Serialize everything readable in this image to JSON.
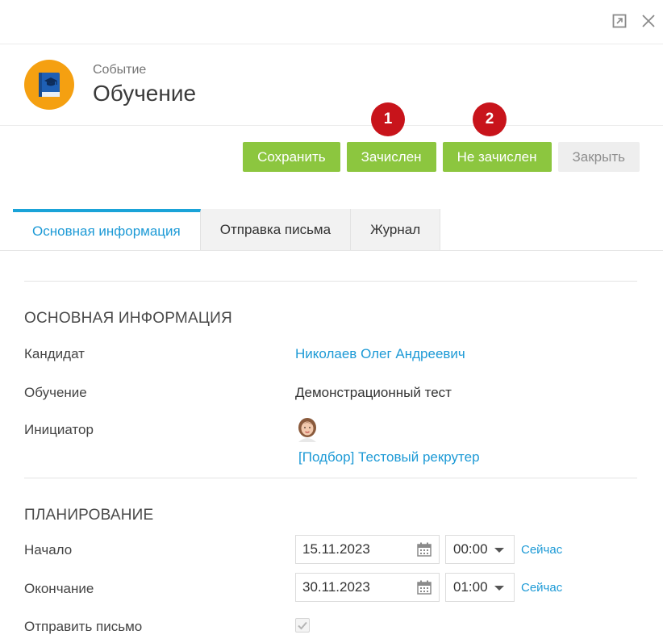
{
  "window": {
    "expand_icon": "expand-icon",
    "close_icon": "close-icon"
  },
  "header": {
    "subtitle": "Событие",
    "title": "Обучение",
    "avatar_icon": "book-graduation-icon",
    "avatar_color": "#f5a011"
  },
  "badges": [
    "1",
    "2"
  ],
  "toolbar": {
    "save_label": "Сохранить",
    "enrolled_label": "Зачислен",
    "not_enrolled_label": "Не зачислен",
    "close_label": "Закрыть",
    "accent_color": "#8cc63f"
  },
  "tabs": [
    {
      "label": "Основная информация",
      "active": true
    },
    {
      "label": "Отправка письма",
      "active": false
    },
    {
      "label": "Журнал",
      "active": false
    }
  ],
  "main_info": {
    "section_title": "ОСНОВНАЯ ИНФОРМАЦИЯ",
    "candidate_label": "Кандидат",
    "candidate_value": "Николаев Олег Андреевич",
    "training_label": "Обучение",
    "training_value": "Демонстрационный тест",
    "initiator_label": "Инициатор",
    "initiator_value": "[Подбор] Тестовый рекрутер"
  },
  "planning": {
    "section_title": "ПЛАНИРОВАНИЕ",
    "start_label": "Начало",
    "start_date": "15.11.2023",
    "start_time": "00:00",
    "end_label": "Окончание",
    "end_date": "30.11.2023",
    "end_time": "01:00",
    "now_label": "Сейчас",
    "send_letter_label": "Отправить письмо",
    "send_letter_checked": true
  }
}
